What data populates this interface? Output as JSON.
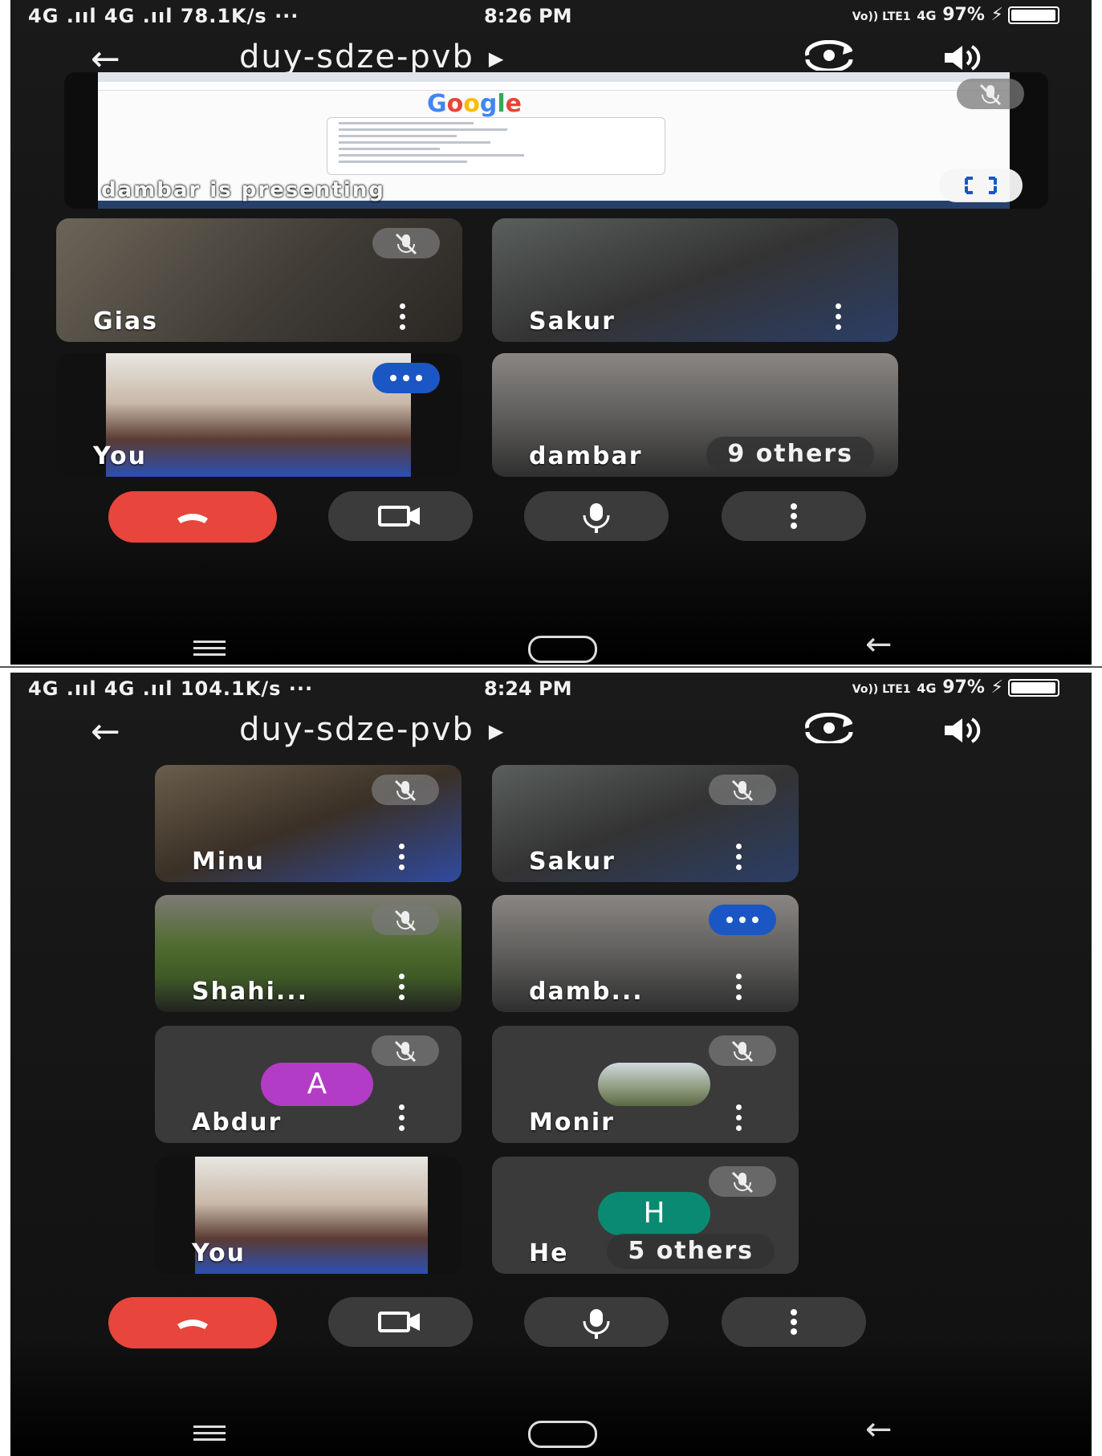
{
  "screen1": {
    "status": {
      "network": "4G .ııl 4G .ııl",
      "speed": "78.1K/s",
      "dots": "···",
      "time": "8:26 PM",
      "lte": "Vo)) LTE1",
      "net2": "4G",
      "battery": "97%",
      "battery_level": 0.97
    },
    "meeting_code": "duy-sdze-pvb",
    "presentation": {
      "google_letters": [
        {
          "ch": "G",
          "color": "#4285f4"
        },
        {
          "ch": "o",
          "color": "#ea4335"
        },
        {
          "ch": "o",
          "color": "#fbbc05"
        },
        {
          "ch": "g",
          "color": "#4285f4"
        },
        {
          "ch": "l",
          "color": "#34a853"
        },
        {
          "ch": "e",
          "color": "#ea4335"
        }
      ],
      "banner": "dambar is presenting"
    },
    "tiles": [
      {
        "name": "Gias",
        "state": "muted"
      },
      {
        "name": "Sakur",
        "state": "none"
      },
      {
        "name": "You",
        "state": "speaking"
      },
      {
        "name": "dambar",
        "others": "9 others"
      }
    ]
  },
  "screen2": {
    "status": {
      "network": "4G .ııl 4G .ııl",
      "speed": "104.1K/s",
      "dots": "···",
      "time": "8:24 PM",
      "lte": "Vo)) LTE1",
      "net2": "4G",
      "battery": "97%",
      "battery_level": 0.97
    },
    "meeting_code": "duy-sdze-pvb",
    "tiles": [
      {
        "name": "Minu",
        "state": "muted"
      },
      {
        "name": "Sakur",
        "state": "muted"
      },
      {
        "name": "Shahi...",
        "state": "muted"
      },
      {
        "name": "damb...",
        "state": "speaking"
      },
      {
        "name": "Abdur",
        "state": "muted",
        "avatar_letter": "A",
        "avatar_color": "#b33cc6"
      },
      {
        "name": "Monir",
        "state": "muted"
      },
      {
        "name": "You",
        "state": "none"
      },
      {
        "name": "He",
        "state": "muted",
        "avatar_letter": "H",
        "avatar_color": "#0b8a73",
        "others": "5 others"
      }
    ]
  },
  "icons": {
    "back": "arrow-left-icon",
    "caret": "play-arrow-icon",
    "flip": "flip-camera-icon",
    "speaker": "speaker-icon",
    "end_call": "phone-hangup-icon",
    "camera": "video-camera-icon",
    "mic": "microphone-icon",
    "more": "more-vert-icon",
    "fullscreen": "fullscreen-icon"
  },
  "colors": {
    "end_call": "#e8453c",
    "speaking": "#1a56c4",
    "control_bg": "#3b3b3b"
  }
}
